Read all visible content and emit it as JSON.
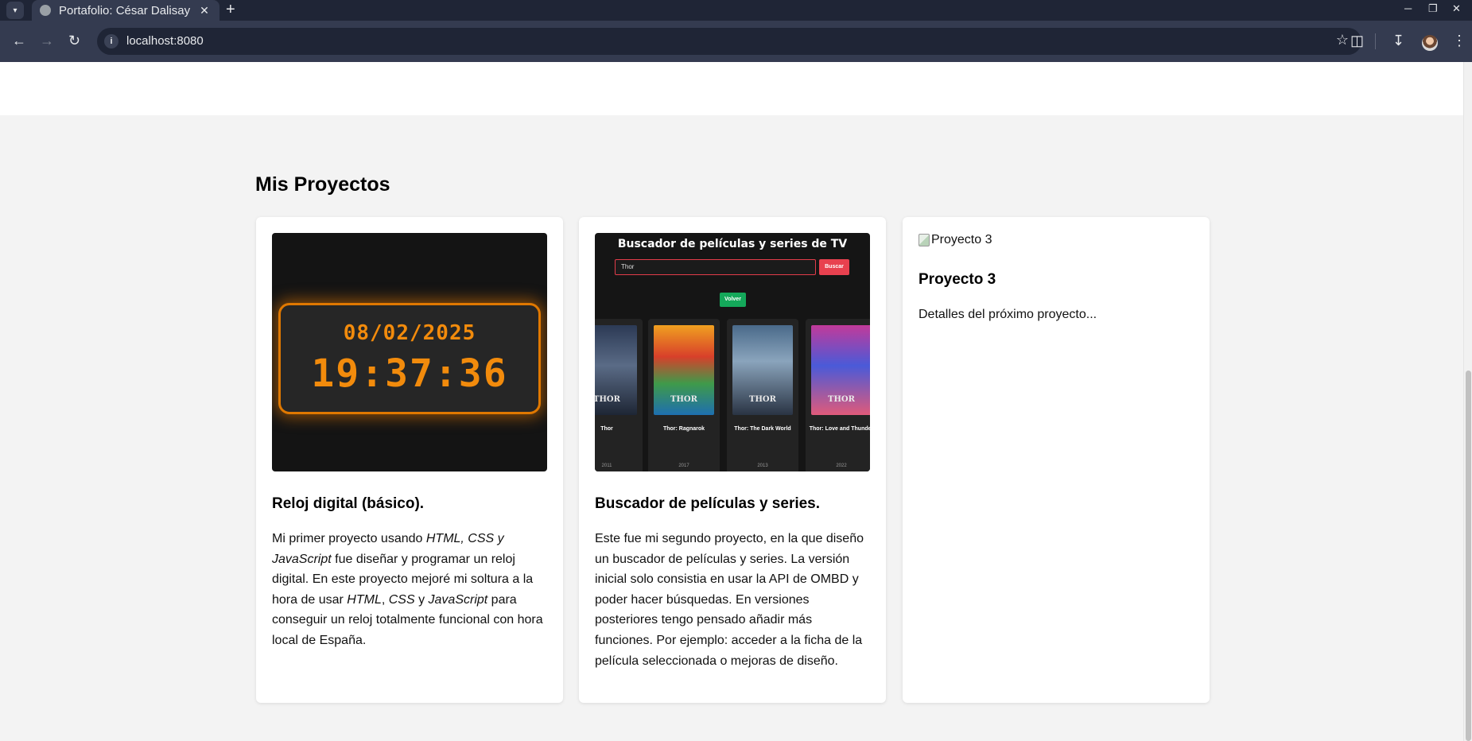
{
  "browser": {
    "tab_title": "Portafolio: César Dalisay",
    "tab_close": "✕",
    "new_tab": "+",
    "url": "localhost:8080"
  },
  "page": {
    "section_title": "Mis Proyectos",
    "projects": [
      {
        "image": {
          "date": "08/02/2025",
          "time": "19:37:36",
          "accent_color": "#f28b0c"
        },
        "title": "Reloj digital (básico).",
        "desc_parts": [
          "Mi primer proyecto usando ",
          "HTML, CSS y JavaScript",
          " fue diseñar y programar un reloj digital. En este proyecto mejoré mi soltura a la hora de usar ",
          "HTML",
          ", ",
          "CSS",
          " y ",
          "JavaScript",
          " para conseguir un reloj totalmente funcional con hora local de España."
        ]
      },
      {
        "image": {
          "title": "Buscador de películas y series de TV",
          "input_value": "Thor",
          "search_button": "Buscar",
          "back_button": "Volver",
          "movies": [
            {
              "name": "Thor",
              "year": "2011",
              "poster_text": "THOR"
            },
            {
              "name": "Thor: Ragnarok",
              "year": "2017",
              "poster_text": "THOR"
            },
            {
              "name": "Thor: The Dark World",
              "year": "2013",
              "poster_text": "THOR"
            },
            {
              "name": "Thor: Love and Thunder",
              "year": "2022",
              "poster_text": "THOR"
            }
          ]
        },
        "title": "Buscador de películas y series.",
        "desc": "Este fue mi segundo proyecto, en la que diseño un buscador de películas y series. La versión inicial solo consistia en usar la API de OMBD y poder hacer búsquedas. En versiones posteriores tengo pensado añadir más funciones. Por ejemplo: acceder a la ficha de la película seleccionada o mejoras de diseño."
      },
      {
        "image_alt": "Proyecto 3",
        "title": "Proyecto 3",
        "desc": "Detalles del próximo proyecto..."
      }
    ]
  }
}
